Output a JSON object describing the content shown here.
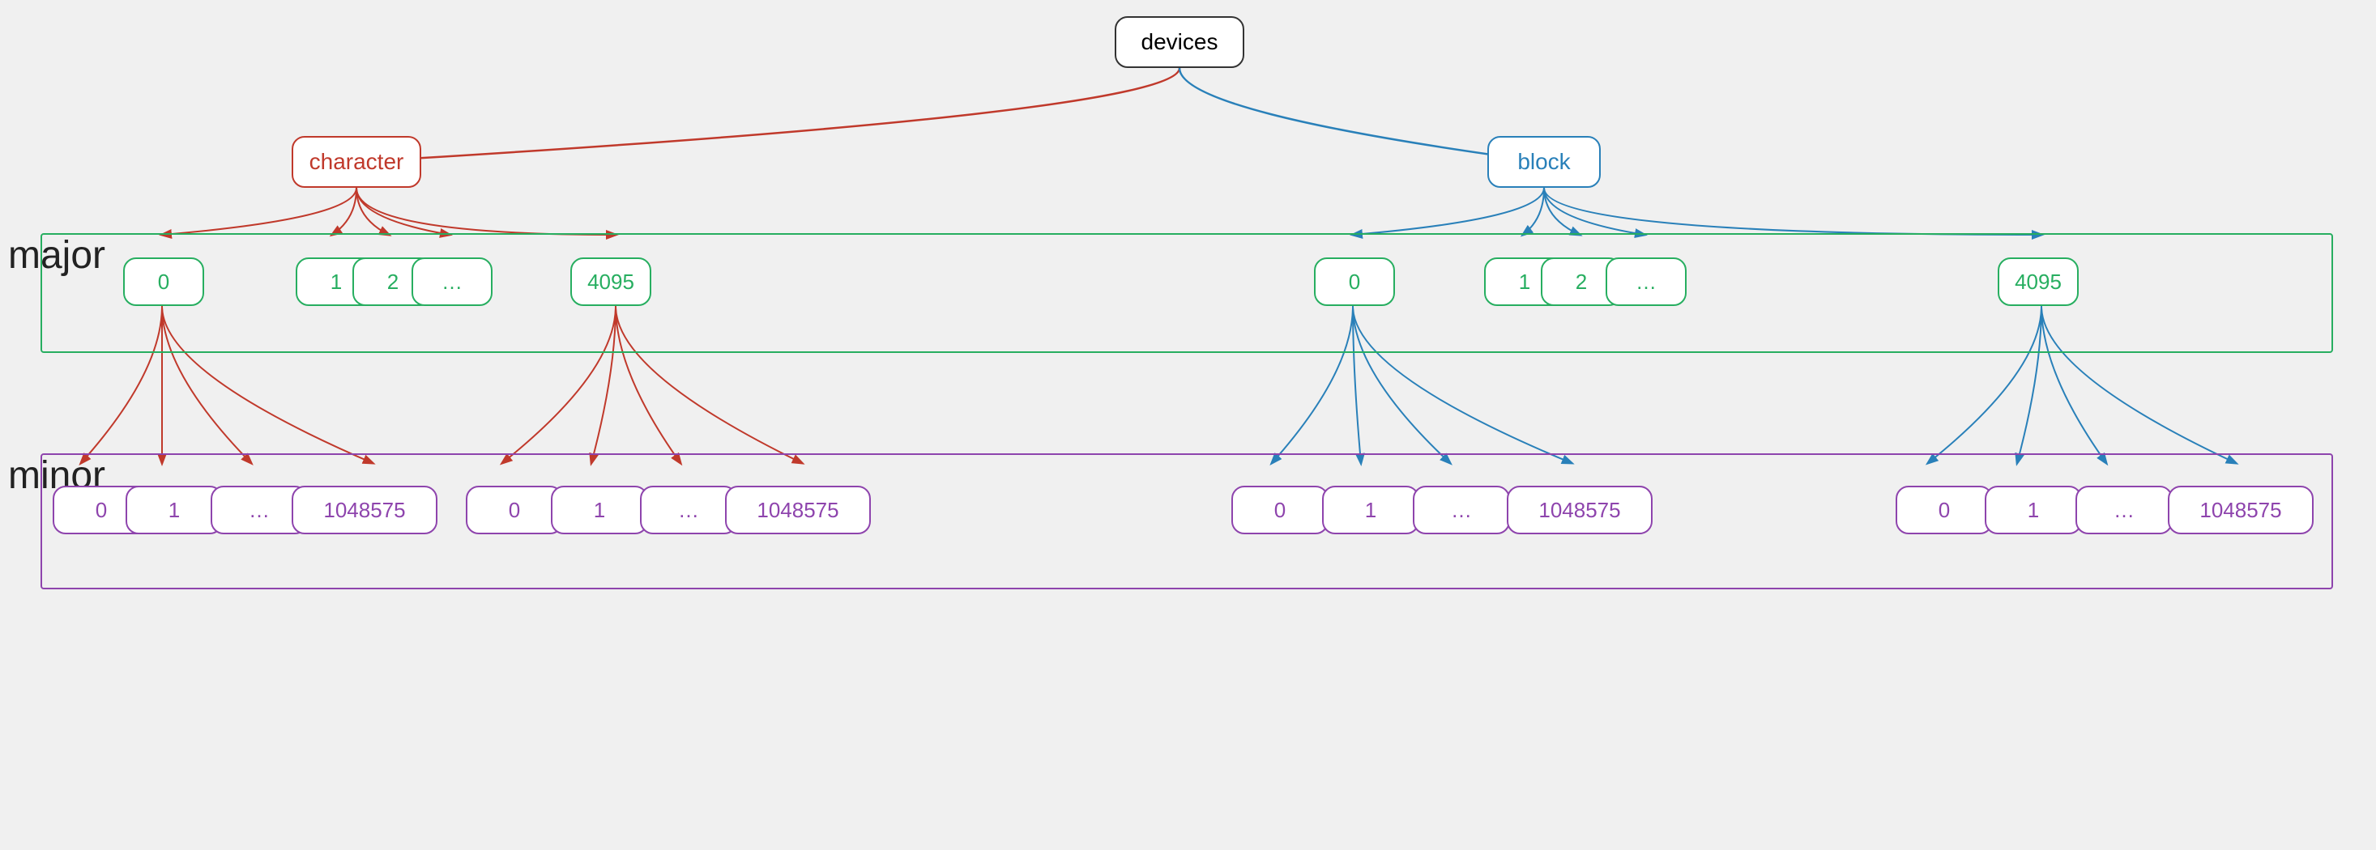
{
  "labels": {
    "devices": "devices",
    "character": "character",
    "block": "block",
    "major": "major",
    "minor": "minor"
  },
  "colors": {
    "red": "#c0392b",
    "blue": "#2980b9",
    "green": "#27ae60",
    "purple": "#8e44ad",
    "dark": "#333"
  },
  "major_nodes_char": [
    "0",
    "1",
    "2",
    "…",
    "4095"
  ],
  "major_nodes_block": [
    "0",
    "1",
    "2",
    "…",
    "4095"
  ],
  "minor_nodes_char_0": [
    "0",
    "1",
    "…",
    "1048575"
  ],
  "minor_nodes_char_4095": [
    "0",
    "1",
    "…",
    "1048575"
  ],
  "minor_nodes_block_0": [
    "0",
    "1",
    "…",
    "1048575"
  ],
  "minor_nodes_block_4095": [
    "0",
    "1",
    "…",
    "1048575"
  ]
}
